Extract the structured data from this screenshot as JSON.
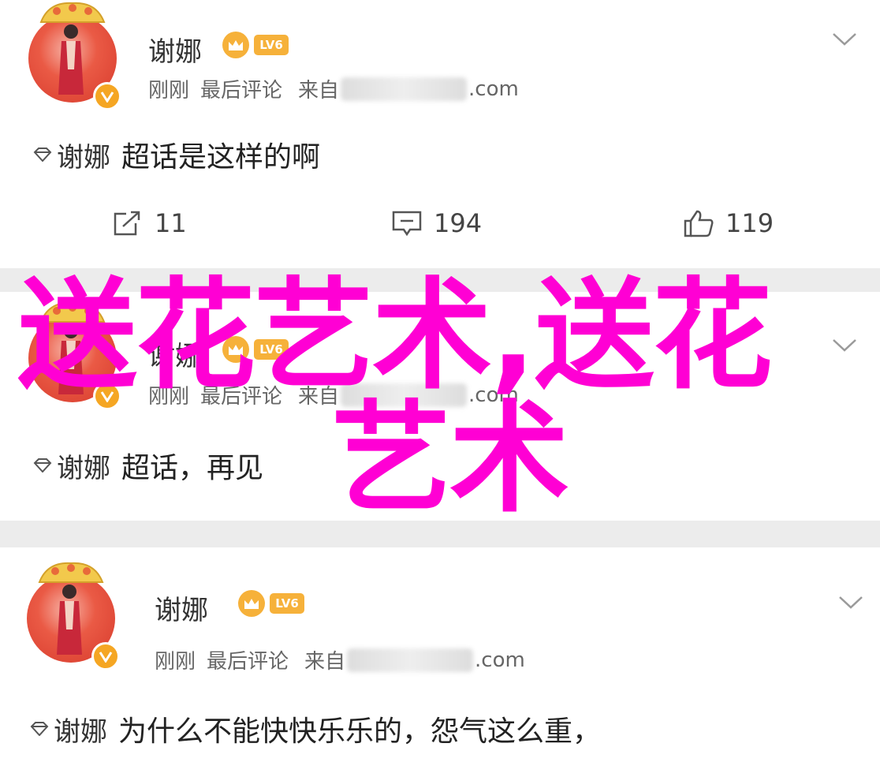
{
  "posts": [
    {
      "username": "谢娜",
      "lv_label": "LV6",
      "meta": {
        "time": "刚刚",
        "action": "最后评论",
        "source_prefix": "来自",
        "source_suffix": ".com"
      },
      "content": {
        "topic": "谢娜",
        "text": "超话是这样的啊"
      },
      "actions": {
        "repost": "11",
        "comment": "194",
        "like": "119"
      }
    },
    {
      "username": "谢娜",
      "lv_label": "LV6",
      "meta": {
        "time": "刚刚",
        "action": "最后评论",
        "source_prefix": "来自",
        "source_suffix": ".com"
      },
      "content": {
        "topic": "谢娜",
        "text": "超话，再见"
      }
    },
    {
      "username": "谢娜",
      "lv_label": "LV6",
      "meta": {
        "time": "刚刚",
        "action": "最后评论",
        "source_prefix": "来自",
        "source_suffix": ".com"
      },
      "content": {
        "topic": "谢娜",
        "text": "为什么不能快快乐乐的，怨气这么重，"
      }
    }
  ],
  "overlay": {
    "line1": "送花艺术,送花",
    "line2": "艺术",
    "color": "#ff00d4"
  },
  "icons": {
    "avatar_badge": "verified-v-icon",
    "more": "chevron-down-icon",
    "repost": "repost-icon",
    "comment": "comment-icon",
    "like": "thumbs-up-icon",
    "topic": "diamond-topic-icon"
  }
}
